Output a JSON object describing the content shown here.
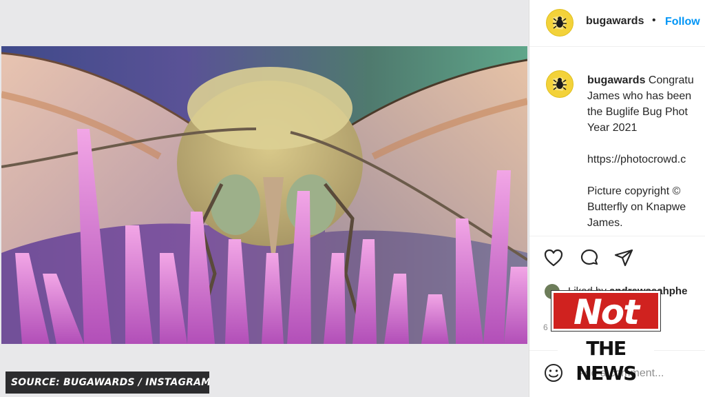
{
  "photo": {
    "description_icon": "butterfly-photo"
  },
  "source_caption": "SOURCE: BUGAWARDS / INSTAGRAM",
  "post_header": {
    "username": "bugawards",
    "separator": "•",
    "follow_label": "Follow",
    "avatar_icon": "bug-logo-icon"
  },
  "caption": {
    "username": "bugawards",
    "line1": "Congratu",
    "line2": "James who has been",
    "line3": "the Buglife Bug Phot",
    "line4": "Year 2021",
    "line5": "https://photocrowd.c",
    "line6": "Picture copyright ©",
    "line7": "Butterfly on Knapwe",
    "line8": "James."
  },
  "actions": {
    "like_icon": "heart-icon",
    "comment_icon": "comment-bubble-icon",
    "share_icon": "paper-plane-icon"
  },
  "liked_by": {
    "prefix": "Liked by",
    "user": "andrewseahphe"
  },
  "count_text": "6",
  "comment_bar": {
    "emoji_icon": "smiley-icon",
    "placeholder": "Add a comment..."
  },
  "logo": {
    "top_word": "Not",
    "bottom_words": "THE NEWS"
  },
  "colors": {
    "follow_blue": "#0095f6",
    "logo_red": "#d0221f",
    "avatar_yellow": "#f3d23a"
  }
}
